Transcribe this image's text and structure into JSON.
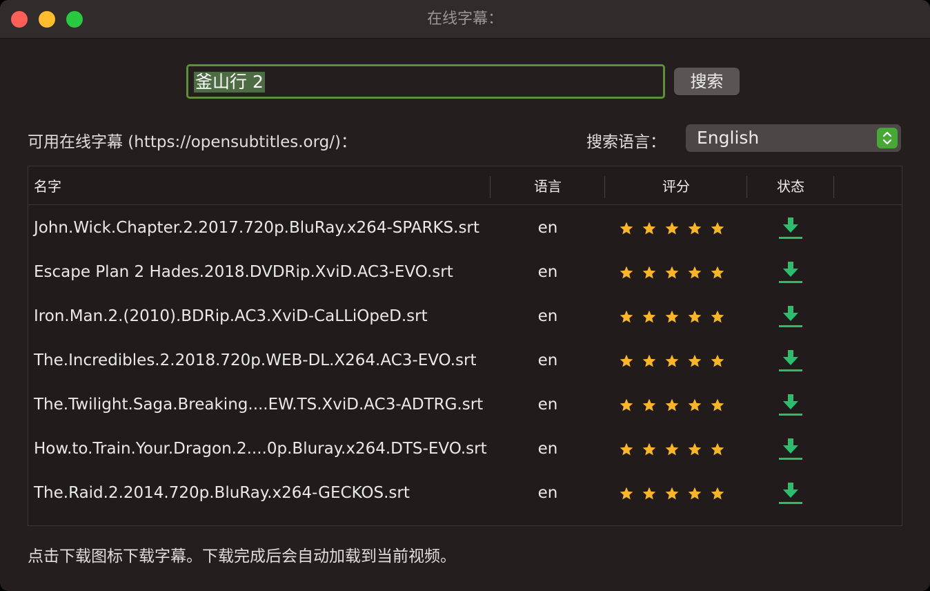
{
  "window": {
    "title": "在线字幕："
  },
  "search": {
    "query": "釜山行 2",
    "button_label": "搜索"
  },
  "labels": {
    "available": "可用在线字幕 (https://opensubtitles.org/)：",
    "search_language": "搜索语言："
  },
  "language_select": {
    "selected": "English"
  },
  "table": {
    "columns": {
      "name": "名字",
      "language": "语言",
      "rating": "评分",
      "status": "状态"
    },
    "rows": [
      {
        "name": "John.Wick.Chapter.2.2017.720p.BluRay.x264-SPARKS.srt",
        "language": "en",
        "rating": 5
      },
      {
        "name": "Escape Plan 2 Hades.2018.DVDRip.XviD.AC3-EVO.srt",
        "language": "en",
        "rating": 5
      },
      {
        "name": "Iron.Man.2.(2010).BDRip.AC3.XviD-CaLLiOpeD.srt",
        "language": "en",
        "rating": 5
      },
      {
        "name": "The.Incredibles.2.2018.720p.WEB-DL.X264.AC3-EVO.srt",
        "language": "en",
        "rating": 5
      },
      {
        "name": "The.Twilight.Saga.Breaking....EW.TS.XviD.AC3-ADTRG.srt",
        "language": "en",
        "rating": 5
      },
      {
        "name": "How.to.Train.Your.Dragon.2....0p.Bluray.x264.DTS-EVO.srt",
        "language": "en",
        "rating": 5
      },
      {
        "name": "The.Raid.2.2014.720p.BluRay.x264-GECKOS.srt",
        "language": "en",
        "rating": 5
      }
    ]
  },
  "footer": {
    "hint": "点击下载图标下载字幕。下载完成后会自动加载到当前视频。"
  },
  "colors": {
    "window_bg": "#251e1f",
    "star": "#f7b52a",
    "download": "#2dbd6e",
    "accent_green": "#48a835",
    "focus_ring": "#5f8e3c"
  },
  "icons": {
    "rating": "star-icon",
    "status": "download-icon",
    "select": "stepper-chevrons-icon"
  }
}
